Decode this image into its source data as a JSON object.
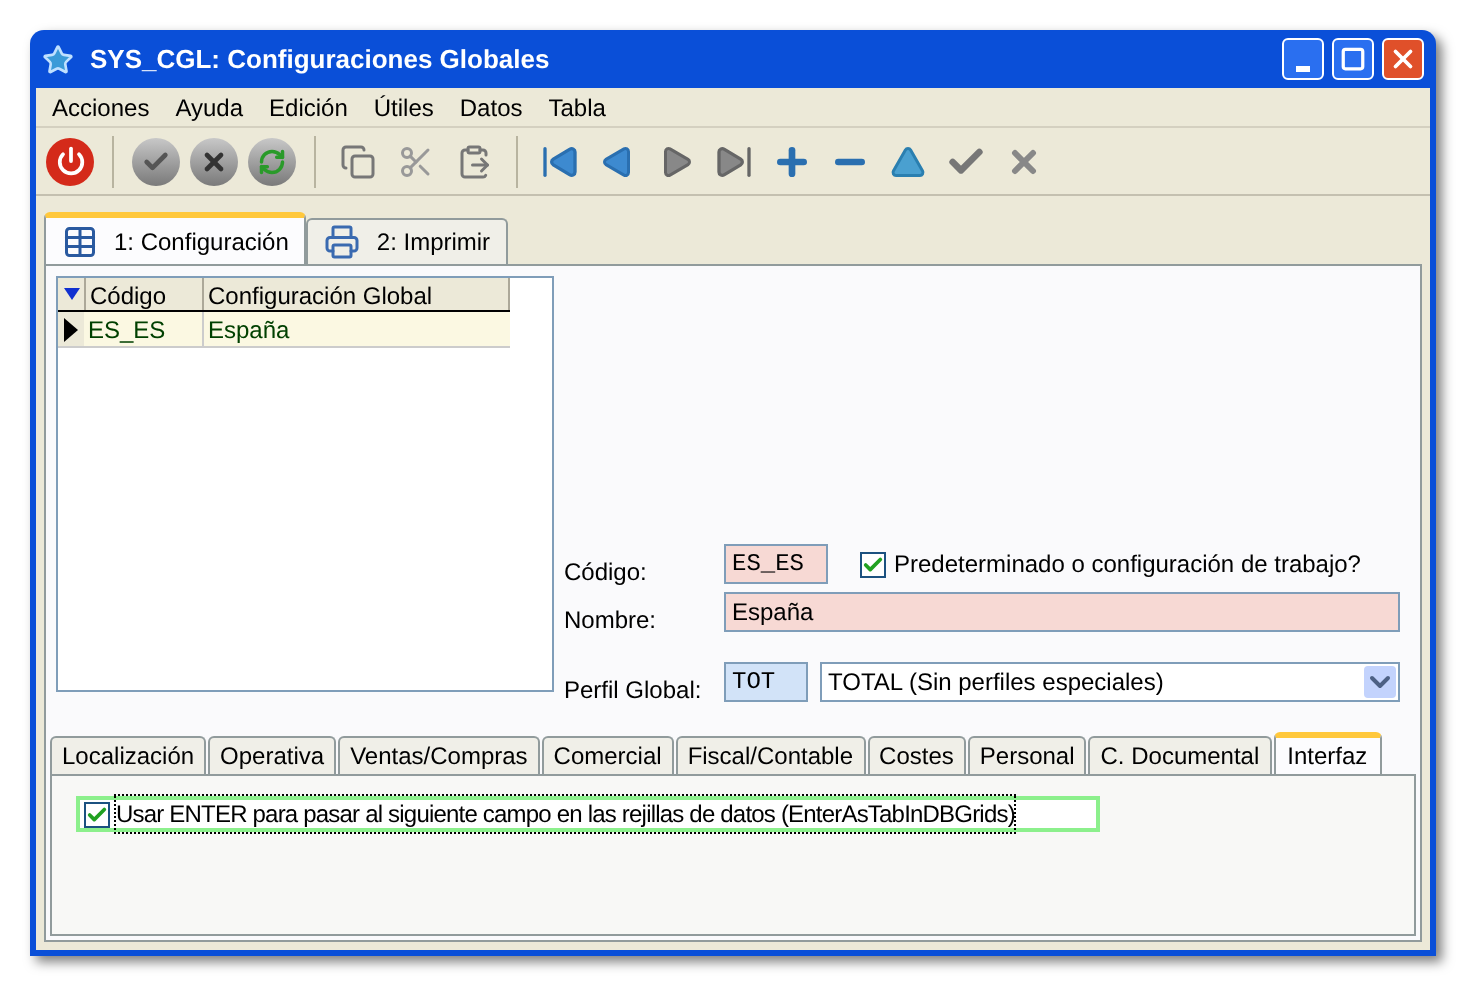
{
  "window": {
    "title": "SYS_CGL: Configuraciones Globales"
  },
  "menu": [
    "Acciones",
    "Ayuda",
    "Edición",
    "Útiles",
    "Datos",
    "Tabla"
  ],
  "toolbar": [
    {
      "kind": "power"
    },
    {
      "kind": "sep"
    },
    {
      "kind": "disk-check"
    },
    {
      "kind": "disk-x"
    },
    {
      "kind": "disk-refresh"
    },
    {
      "kind": "sep"
    },
    {
      "kind": "copy"
    },
    {
      "kind": "cut"
    },
    {
      "kind": "paste"
    },
    {
      "kind": "sep"
    },
    {
      "kind": "first"
    },
    {
      "kind": "prev"
    },
    {
      "kind": "next"
    },
    {
      "kind": "last"
    },
    {
      "kind": "add"
    },
    {
      "kind": "remove"
    },
    {
      "kind": "up"
    },
    {
      "kind": "accept"
    },
    {
      "kind": "cancel"
    }
  ],
  "tabs": [
    {
      "label": "1: Configuración",
      "kind": "table",
      "selected": true
    },
    {
      "label": "2: Imprimir",
      "kind": "printer",
      "selected": false
    }
  ],
  "grid": {
    "columns": [
      "Código",
      "Configuración Global"
    ],
    "rows": [
      {
        "cells": [
          "ES_ES",
          "España"
        ],
        "selected": true
      }
    ]
  },
  "form": {
    "codigo": {
      "label": "Código:",
      "value": "ES_ES"
    },
    "default": {
      "label": "Predeterminado o configuración de trabajo?",
      "checked": true
    },
    "nombre": {
      "label": "Nombre:",
      "value": "España"
    },
    "perfil": {
      "label": "Perfil Global:",
      "code": "TOT",
      "value": "TOTAL (Sin perfiles especiales)"
    }
  },
  "subtabs": [
    {
      "label": "Localización",
      "selected": false
    },
    {
      "label": "Operativa",
      "selected": false
    },
    {
      "label": "Ventas/Compras",
      "selected": false
    },
    {
      "label": "Comercial",
      "selected": false
    },
    {
      "label": "Fiscal/Contable",
      "selected": false
    },
    {
      "label": "Costes",
      "selected": false
    },
    {
      "label": "Personal",
      "selected": false
    },
    {
      "label": "C. Documental",
      "selected": false
    },
    {
      "label": "Interfaz",
      "selected": true
    }
  ],
  "options": [
    {
      "label": "Usar ENTER para pasar al siguiente campo en las rejillas de datos (EnterAsTabInDBGrids)",
      "checked": true,
      "focused": true
    }
  ]
}
